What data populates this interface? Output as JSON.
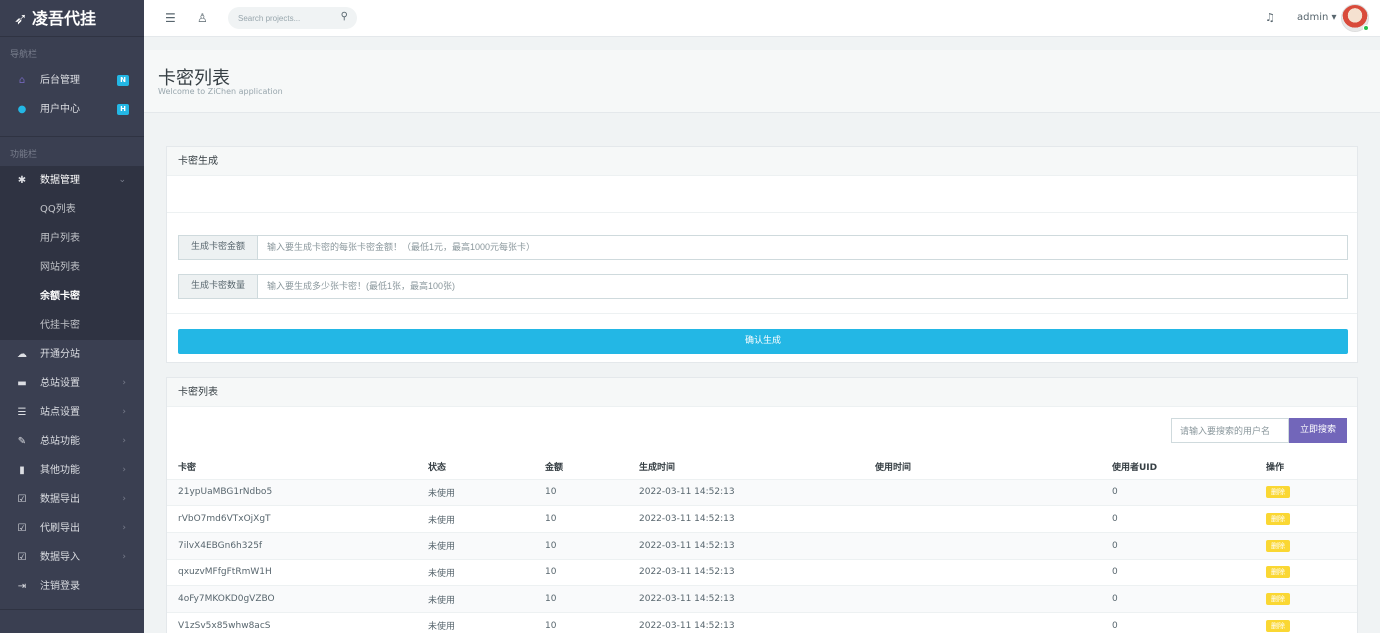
{
  "brand": {
    "name": "凌吾代挂"
  },
  "sidebar": {
    "section_nav": "导航栏",
    "section_func": "功能栏",
    "nav_items": [
      {
        "label": "后台管理",
        "badge": "N",
        "icon": "home-icon"
      },
      {
        "label": "用户中心",
        "badge": "H",
        "icon": "question-circle-icon"
      }
    ],
    "data_mgmt": {
      "label": "数据管理",
      "icon": "gear-icon"
    },
    "sub_items": [
      "QQ列表",
      "用户列表",
      "网站列表",
      "余额卡密",
      "代挂卡密"
    ],
    "func_items": [
      {
        "label": "开通分站",
        "icon": "cloud-upload-icon"
      },
      {
        "label": "总站设置",
        "icon": "briefcase-icon"
      },
      {
        "label": "站点设置",
        "icon": "list-icon"
      },
      {
        "label": "总站功能",
        "icon": "edit-icon"
      },
      {
        "label": "其他功能",
        "icon": "file-icon"
      },
      {
        "label": "数据导出",
        "icon": "check-square-icon"
      },
      {
        "label": "代刷导出",
        "icon": "check-square-icon"
      },
      {
        "label": "数据导入",
        "icon": "check-square-icon"
      },
      {
        "label": "注销登录",
        "icon": "sign-out-icon"
      }
    ]
  },
  "header": {
    "search_placeholder": "Search projects...",
    "user": "admin"
  },
  "page": {
    "title": "卡密列表",
    "subtitle": "Welcome to ZiChen application"
  },
  "generate": {
    "title": "卡密生成",
    "amount_label": "生成卡密金额",
    "amount_placeholder": "输入要生成卡密的每张卡密金额！（最低1元，最高1000元每张卡）",
    "count_label": "生成卡密数量",
    "count_placeholder": "输入要生成多少张卡密！(最低1张，最高100张)",
    "submit": "确认生成"
  },
  "list": {
    "title": "卡密列表",
    "search_placeholder": "请输入要搜索的用户名",
    "search_button": "立即搜索",
    "columns": [
      "卡密",
      "状态",
      "金额",
      "生成时间",
      "使用时间",
      "使用者UID",
      "操作"
    ],
    "delete_label": "删除",
    "rows": [
      [
        "21ypUaMBG1rNdbo5",
        "未使用",
        "10",
        "2022-03-11 14:52:13",
        "",
        "0"
      ],
      [
        "rVbO7md6VTxOjXgT",
        "未使用",
        "10",
        "2022-03-11 14:52:13",
        "",
        "0"
      ],
      [
        "7ilvX4EBGn6h325f",
        "未使用",
        "10",
        "2022-03-11 14:52:13",
        "",
        "0"
      ],
      [
        "qxuzvMFfgFtRmW1H",
        "未使用",
        "10",
        "2022-03-11 14:52:13",
        "",
        "0"
      ],
      [
        "4oFy7MKOKD0gVZBO",
        "未使用",
        "10",
        "2022-03-11 14:52:13",
        "",
        "0"
      ],
      [
        "V1zSv5x85whw8acS",
        "未使用",
        "10",
        "2022-03-11 14:52:13",
        "",
        "0"
      ]
    ]
  }
}
